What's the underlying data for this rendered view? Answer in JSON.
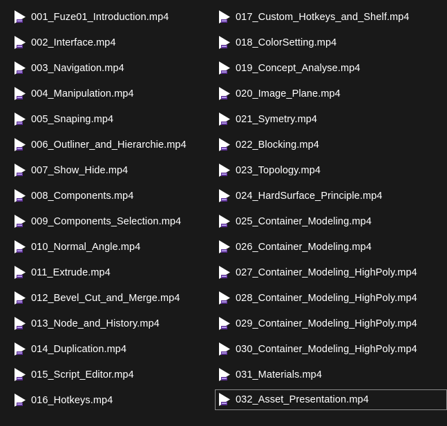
{
  "files_left": [
    "001_Fuze01_Introduction.mp4",
    "002_Interface.mp4",
    "003_Navigation.mp4",
    "004_Manipulation.mp4",
    "005_Snaping.mp4",
    "006_Outliner_and_Hierarchie.mp4",
    "007_Show_Hide.mp4",
    "008_Components.mp4",
    "009_Components_Selection.mp4",
    "010_Normal_Angle.mp4",
    "011_Extrude.mp4",
    "012_Bevel_Cut_and_Merge.mp4",
    "013_Node_and_History.mp4",
    "014_Duplication.mp4",
    "015_Script_Editor.mp4",
    "016_Hotkeys.mp4"
  ],
  "files_right": [
    "017_Custom_Hotkeys_and_Shelf.mp4",
    "018_ColorSetting.mp4",
    "019_Concept_Analyse.mp4",
    "020_Image_Plane.mp4",
    "021_Symetry.mp4",
    "022_Blocking.mp4",
    "023_Topology.mp4",
    "024_HardSurface_Principle.mp4",
    "025_Container_Modeling.mp4",
    "026_Container_Modeling.mp4",
    "027_Container_Modeling_HighPoly.mp4",
    "028_Container_Modeling_HighPoly.mp4",
    "029_Container_Modeling_HighPoly.mp4",
    "030_Container_Modeling_HighPoly.mp4",
    "031_Materials.mp4",
    "032_Asset_Presentation.mp4"
  ],
  "selected_file": "032_Asset_Presentation.mp4",
  "icon": {
    "name": "video-play-file-icon",
    "fill_color": "#ffffff",
    "badge_color": "#5a2d91"
  },
  "colors": {
    "background": "#191919",
    "text": "#ffffff",
    "selection_border": "#8a8a8a"
  }
}
